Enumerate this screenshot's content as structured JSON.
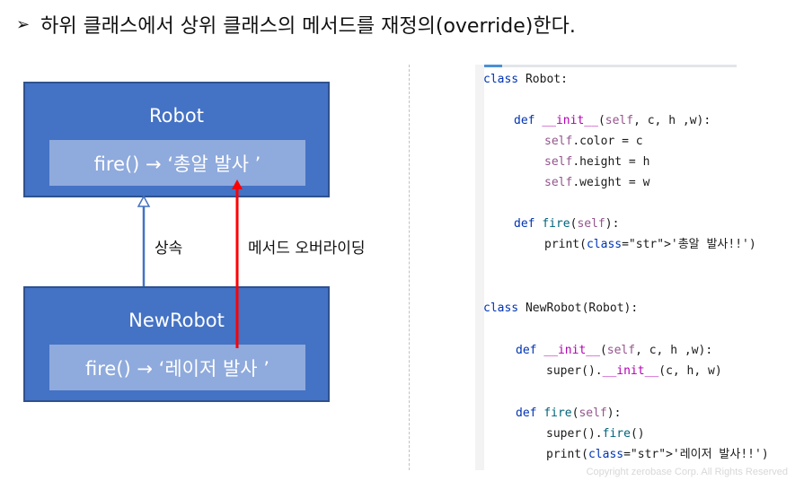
{
  "heading": {
    "bullet": "➢",
    "text": "하위 클래스에서 상위 클래스의 메서드를 재정의(override)한다."
  },
  "diagram": {
    "parent": {
      "title": "Robot",
      "method": "fire() → ‘총알 발사 ’"
    },
    "child": {
      "title": "NewRobot",
      "method": "fire() → ‘레이저 발사 ’"
    },
    "inherit_label": "상속",
    "override_label": "메서드 오버라이딩",
    "colors": {
      "box": "#4472c4",
      "method_box": "#8faadc",
      "override_arrow": "#ff0000"
    }
  },
  "code": {
    "lines": [
      "class Robot:",
      "def __init__(self, c, h ,w):",
      "self.color = c",
      "self.height = h",
      "self.weight = w",
      "def fire(self):",
      "print('총알 발사!!')",
      "class NewRobot(Robot):",
      "def __init__(self, c, h ,w):",
      "super().__init__(c, h, w)",
      "def fire(self):",
      "super().fire()",
      "print('레이저 발사!!')"
    ]
  },
  "footer": {
    "copyright": "Copyright zerobase Corp. All Rights Reserved"
  }
}
